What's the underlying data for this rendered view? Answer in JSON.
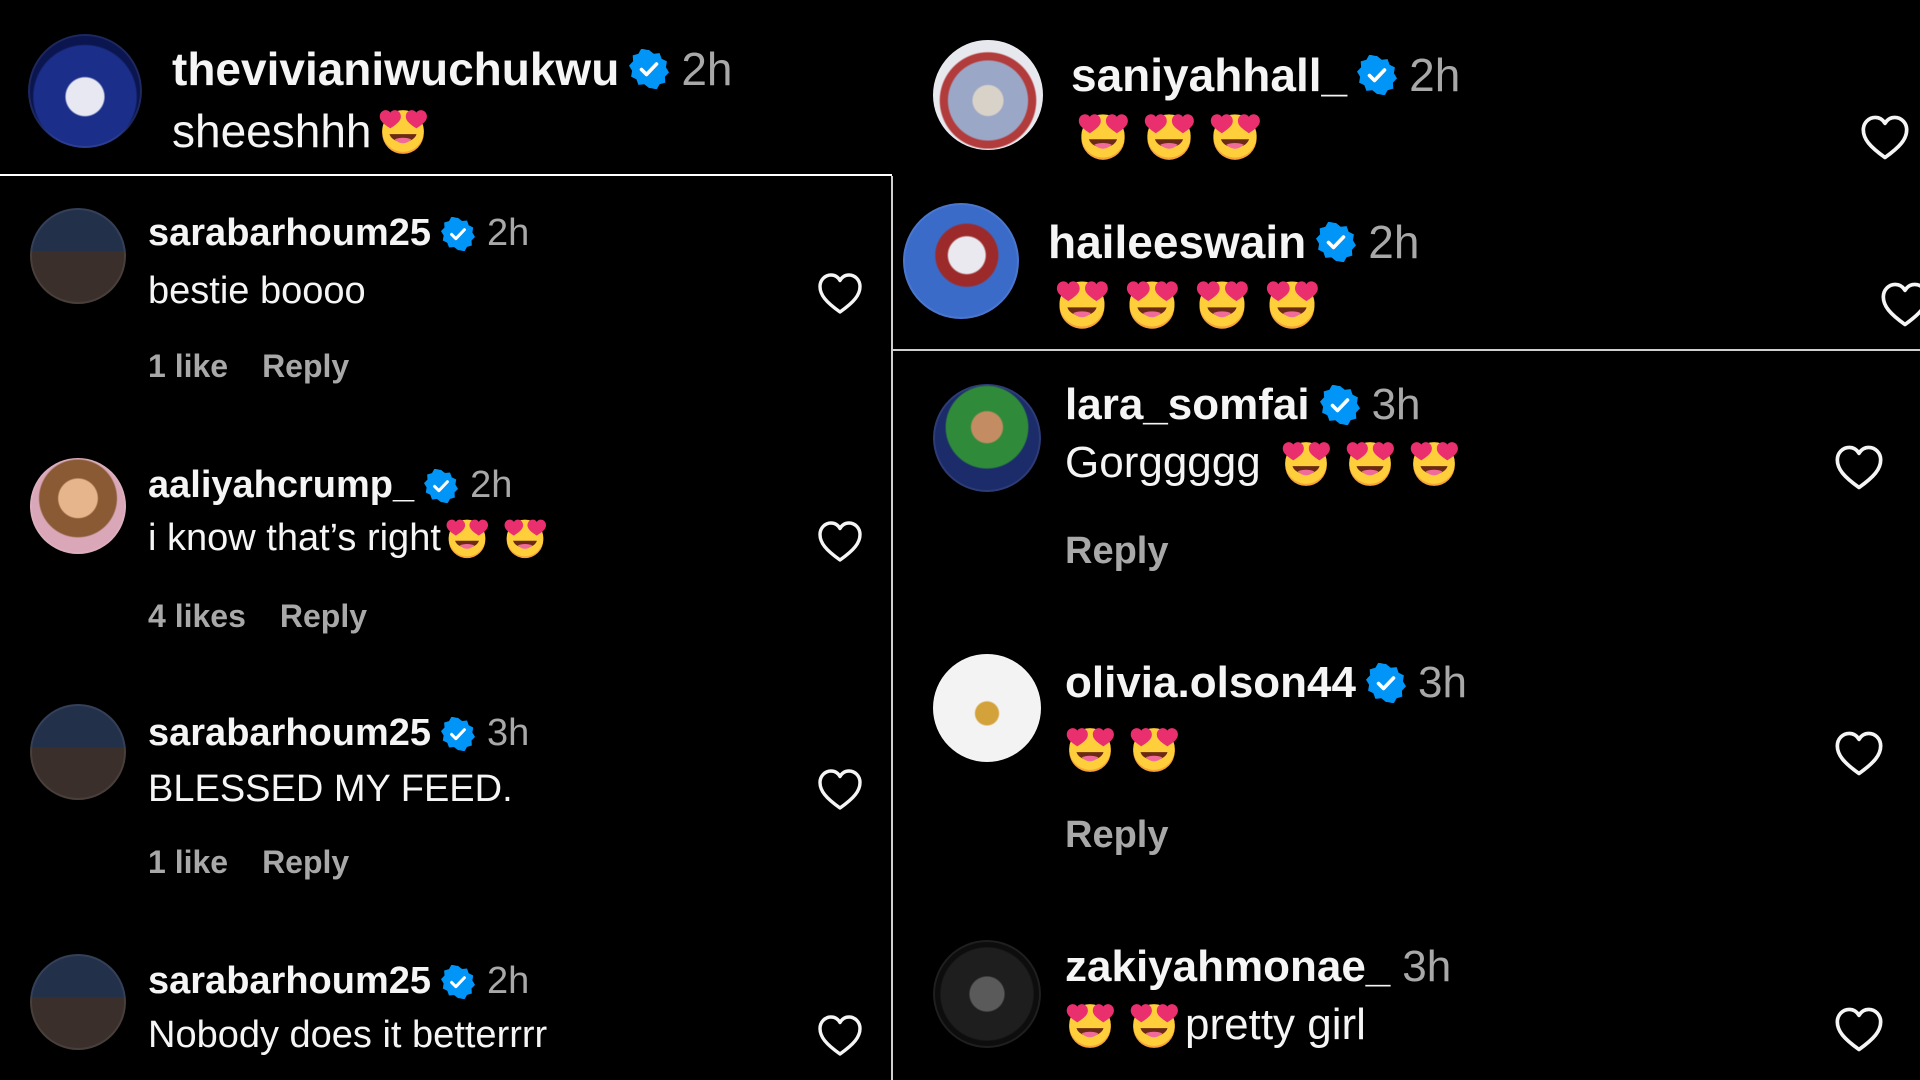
{
  "colors": {
    "background": "#000000",
    "text": "#f5f5f5",
    "muted": "#a8a8a8",
    "verified": "#0095f6",
    "emoji_face": "#f94b9e"
  },
  "left_panel": {
    "top_comment": {
      "username": "thevivianiwuchukwu",
      "time": "2h",
      "text": "sheeshhh",
      "emoji_count": 1,
      "verified": true
    },
    "comments": [
      {
        "username": "sarabarhoum25",
        "time": "2h",
        "text": "bestie boooo",
        "likes": "1 like",
        "reply": "Reply",
        "verified": true
      },
      {
        "username": "aaliyahcrump_",
        "time": "2h",
        "text": "i know that’s right",
        "emoji_count": 2,
        "likes": "4 likes",
        "reply": "Reply",
        "verified": true
      },
      {
        "username": "sarabarhoum25",
        "time": "3h",
        "text": "BLESSED MY FEED.",
        "likes": "1 like",
        "reply": "Reply",
        "verified": true
      },
      {
        "username": "sarabarhoum25",
        "time": "2h",
        "text": "Nobody does it betterrrr",
        "verified": true
      }
    ]
  },
  "right_panel": {
    "top_comments": [
      {
        "username": "saniyahhall_",
        "time": "2h",
        "emoji_count": 3,
        "verified": true
      },
      {
        "username": "haileeswain",
        "time": "2h",
        "emoji_count": 4,
        "verified": true
      }
    ],
    "comments": [
      {
        "username": "lara_somfai",
        "time": "3h",
        "text": "Gorggggg",
        "emoji_count": 3,
        "reply": "Reply",
        "verified": true
      },
      {
        "username": "olivia.olson44",
        "time": "3h",
        "emoji_count": 2,
        "reply": "Reply",
        "verified": true
      },
      {
        "username": "zakiyahmonae_",
        "time": "3h",
        "text": "pretty girl",
        "emoji_count": 2,
        "verified": false
      }
    ]
  },
  "icons": {
    "like": "heart-outline-icon",
    "verified": "verified-badge-icon",
    "emoji": "heart-eyes-emoji"
  }
}
